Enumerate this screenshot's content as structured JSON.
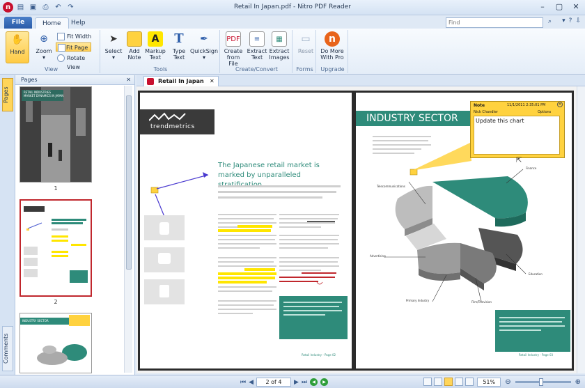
{
  "window": {
    "title": "Retail In Japan.pdf - Nitro PDF Reader",
    "qat_icons": [
      "nitro-logo-icon",
      "open-icon",
      "save-icon",
      "print-icon",
      "undo-icon",
      "redo-icon"
    ]
  },
  "tabs": {
    "file": "File",
    "home": "Home",
    "help": "Help"
  },
  "find": {
    "placeholder": "Find"
  },
  "ribbon": {
    "view": {
      "label": "View",
      "hand": "Hand",
      "zoom": "Zoom",
      "fit_width": "Fit Width",
      "fit_page": "Fit Page",
      "rotate_view": "Rotate View"
    },
    "tools": {
      "label": "Tools",
      "select": "Select",
      "add_note": "Add\nNote",
      "markup_text": "Markup\nText",
      "type_text": "Type\nText",
      "quicksign": "QuickSign"
    },
    "create": {
      "label": "Create/Convert",
      "create_from_file": "Create\nfrom File",
      "extract_text": "Extract\nText",
      "extract_images": "Extract\nImages"
    },
    "forms": {
      "label": "Forms",
      "reset": "Reset"
    },
    "upgrade": {
      "label": "Upgrade",
      "do_more": "Do More\nWith Pro"
    }
  },
  "sidebar": {
    "pages_tab": "Pages",
    "comments_tab": "Comments",
    "panel_title": "Pages",
    "thumb_numbers": [
      "1",
      "2"
    ]
  },
  "thumbnails": {
    "page1": {
      "caption": "RETAIL INDUSTRIES\nMARKET DYNAMICS IN JAPAN"
    },
    "page3": {
      "caption": "INDUSTRY SECTOR"
    }
  },
  "document": {
    "tab_label": "Retail In Japan",
    "left_page": {
      "logo": "trendmetrics",
      "headline": "The Japanese retail market is marked by unparalleled stratification.",
      "footer": "Retail Industry - Page 02"
    },
    "right_page": {
      "banner": "INDUSTRY SECTOR",
      "pie_labels": {
        "telecom": "Telecommunications",
        "finance": "Finance",
        "advertising": "Advertising",
        "education": "Education",
        "primary": "Primary Industry",
        "film": "Film/Television"
      },
      "footer": "Retail Industry - Page 03"
    },
    "note": {
      "header": "Note",
      "datetime": "11/1/2011 2:35:01 PM",
      "author": "Nick Chandler",
      "options": "Options",
      "text": "Update this chart"
    }
  },
  "status": {
    "page_indicator": "2 of 4",
    "zoom": "51%"
  },
  "colors": {
    "teal": "#2e8b7a",
    "highlight": "#ffe600",
    "note_yellow": "#ffd23f",
    "accent_blue": "#2a5ba8"
  }
}
